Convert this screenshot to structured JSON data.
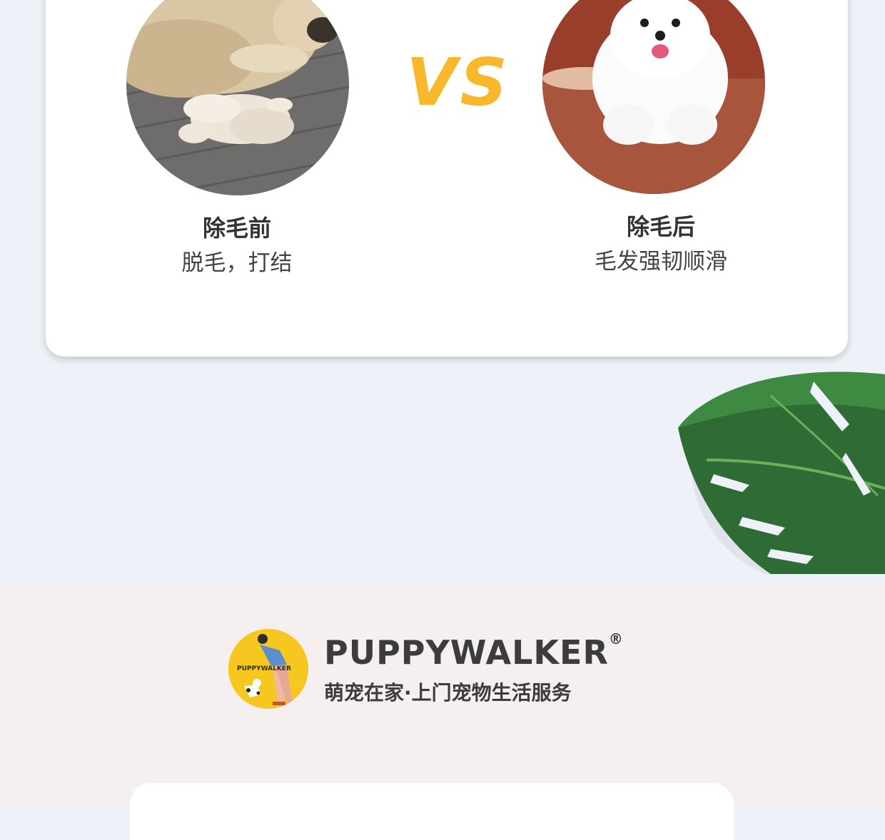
{
  "comparison": {
    "vs_label": "VS",
    "before": {
      "title": "除毛前",
      "description": "脱毛，打结",
      "image": "golden-retriever-shedding-photo"
    },
    "after": {
      "title": "除毛后",
      "description": "毛发强韧顺滑",
      "image": "fluffy-white-pomeranian-photo"
    }
  },
  "decoration": {
    "leaf": "monstera-leaf"
  },
  "brand": {
    "logo_text": "PUPPYWALKER",
    "name": "PUPPYWALKER",
    "registered_mark": "®",
    "tagline": "萌宠在家·上门宠物生活服务"
  },
  "colors": {
    "accent_yellow": "#f7b82c",
    "background": "#eef1f7",
    "band": "#f5efef",
    "text_dark": "#333333"
  }
}
